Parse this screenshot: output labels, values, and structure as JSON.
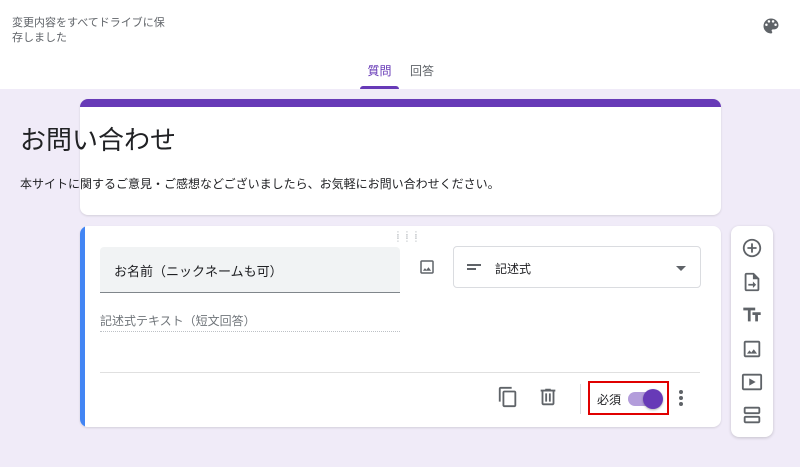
{
  "header": {
    "save_status": "変更内容をすべてドライブに保存しました",
    "palette_icon": "palette-icon"
  },
  "tabs": [
    {
      "label": "質問",
      "active": true
    },
    {
      "label": "回答",
      "active": false
    }
  ],
  "form": {
    "title": "お問い合わせ",
    "description": "本サイトに関するご意見・ご感想などございましたら、お気軽にお問い合わせください。",
    "accent_color": "#673ab7"
  },
  "question": {
    "title": "お名前（ニックネームも可）",
    "type": "記述式",
    "answer_placeholder": "記述式テキスト（短文回答）",
    "required_label": "必須",
    "required": true,
    "accent_color": "#4285f4"
  },
  "sidebar": {
    "items": [
      {
        "icon": "add-question-icon"
      },
      {
        "icon": "import-questions-icon"
      },
      {
        "icon": "add-title-icon"
      },
      {
        "icon": "add-image-icon"
      },
      {
        "icon": "add-video-icon"
      },
      {
        "icon": "add-section-icon"
      }
    ]
  },
  "highlight_color": "#e00000"
}
